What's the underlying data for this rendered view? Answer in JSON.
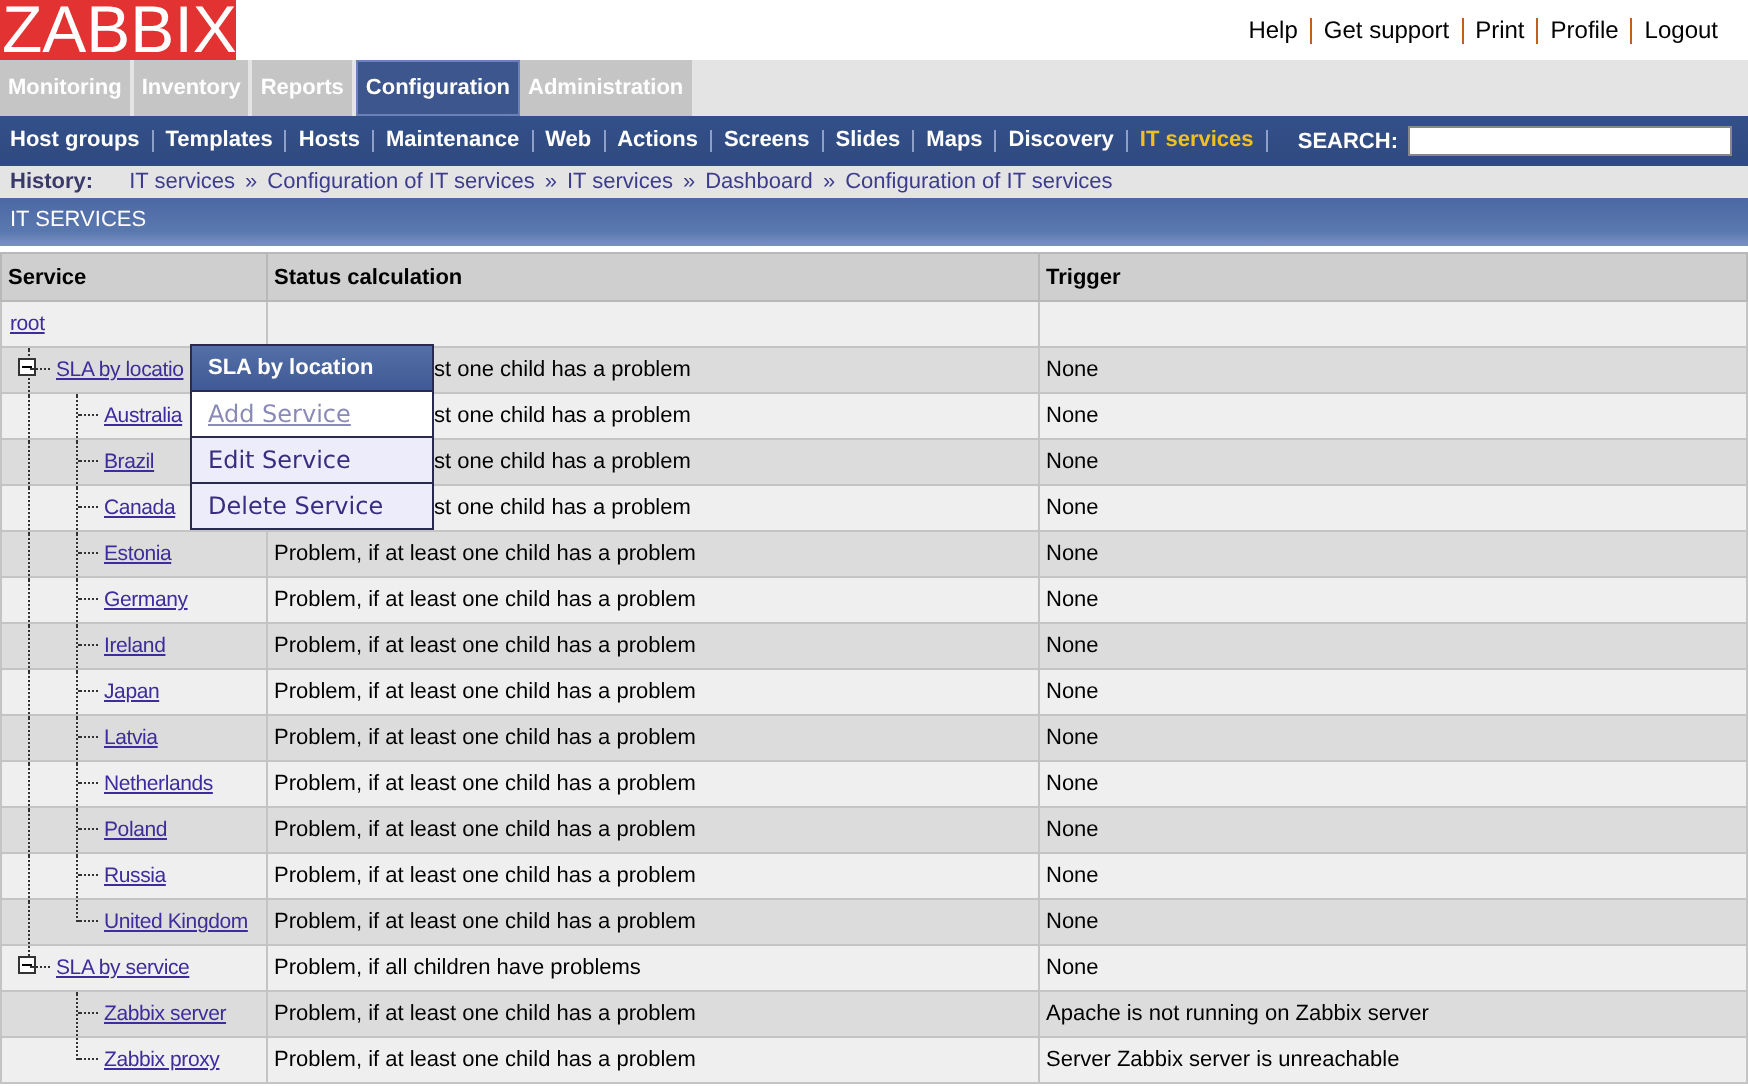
{
  "logo": "ZABBIX",
  "top_links": [
    "Help",
    "Get support",
    "Print",
    "Profile",
    "Logout"
  ],
  "main_tabs": [
    {
      "label": "Monitoring",
      "selected": false
    },
    {
      "label": "Inventory",
      "selected": false
    },
    {
      "label": "Reports",
      "selected": false
    },
    {
      "label": "Configuration",
      "selected": true
    },
    {
      "label": "Administration",
      "selected": false
    }
  ],
  "sub_menu": [
    {
      "label": "Host groups",
      "selected": false
    },
    {
      "label": "Templates",
      "selected": false
    },
    {
      "label": "Hosts",
      "selected": false
    },
    {
      "label": "Maintenance",
      "selected": false
    },
    {
      "label": "Web",
      "selected": false
    },
    {
      "label": "Actions",
      "selected": false
    },
    {
      "label": "Screens",
      "selected": false
    },
    {
      "label": "Slides",
      "selected": false
    },
    {
      "label": "Maps",
      "selected": false
    },
    {
      "label": "Discovery",
      "selected": false
    },
    {
      "label": "IT services",
      "selected": true
    }
  ],
  "search": {
    "label": "SEARCH:"
  },
  "history": {
    "label": "History:",
    "separator": "»",
    "items": [
      "IT services",
      "Configuration of IT services",
      "IT services",
      "Dashboard",
      "Configuration of IT services"
    ]
  },
  "page_title": "IT SERVICES",
  "table": {
    "columns": [
      "Service",
      "Status calculation",
      "Trigger"
    ],
    "rows": [
      {
        "name": "root",
        "children": [
          {
            "name": "SLA by locatio",
            "status": "st one child has a problem",
            "trigger": "None",
            "kind": "covered",
            "expanded": true,
            "children": [
              {
                "name": "Australia",
                "status": "st one child has a problem",
                "trigger": "None",
                "kind": "covered"
              },
              {
                "name": "Brazil",
                "status": "st one child has a problem",
                "trigger": "None",
                "kind": "covered"
              },
              {
                "name": "Canada",
                "status": "st one child has a problem",
                "trigger": "None",
                "kind": "covered"
              },
              {
                "name": "Estonia",
                "status": "Problem, if at least one child has a problem",
                "trigger": "None",
                "kind": "plain"
              },
              {
                "name": "Germany",
                "status": "Problem, if at least one child has a problem",
                "trigger": "None",
                "kind": "plain"
              },
              {
                "name": "Ireland",
                "status": "Problem, if at least one child has a problem",
                "trigger": "None",
                "kind": "plain"
              },
              {
                "name": "Japan",
                "status": "Problem, if at least one child has a problem",
                "trigger": "None",
                "kind": "plain"
              },
              {
                "name": "Latvia",
                "status": "Problem, if at least one child has a problem",
                "trigger": "None",
                "kind": "plain"
              },
              {
                "name": "Netherlands",
                "status": "Problem, if at least one child has a problem",
                "trigger": "None",
                "kind": "plain"
              },
              {
                "name": "Poland",
                "status": "Problem, if at least one child has a problem",
                "trigger": "None",
                "kind": "plain"
              },
              {
                "name": "Russia",
                "status": "Problem, if at least one child has a problem",
                "trigger": "None",
                "kind": "plain"
              },
              {
                "name": "United Kingdom",
                "status": "Problem, if at least one child has a problem",
                "trigger": "None",
                "kind": "plain"
              }
            ]
          },
          {
            "name": "SLA by service",
            "status": "Problem, if all children have problems",
            "trigger": "None",
            "kind": "plain",
            "expanded": true,
            "children": [
              {
                "name": "Zabbix server",
                "status": "Problem, if at least one child has a problem",
                "trigger": "Apache is not running on Zabbix server",
                "kind": "plain"
              },
              {
                "name": "Zabbix proxy",
                "status": "Problem, if at least one child has a problem",
                "trigger": "Server Zabbix server is unreachable",
                "kind": "plain"
              }
            ]
          }
        ]
      }
    ]
  },
  "context_menu": {
    "title": "SLA by location",
    "items": [
      {
        "label": "Add Service",
        "highlighted": true
      },
      {
        "label": "Edit Service",
        "highlighted": false
      },
      {
        "label": "Delete Service",
        "highlighted": false
      }
    ]
  }
}
